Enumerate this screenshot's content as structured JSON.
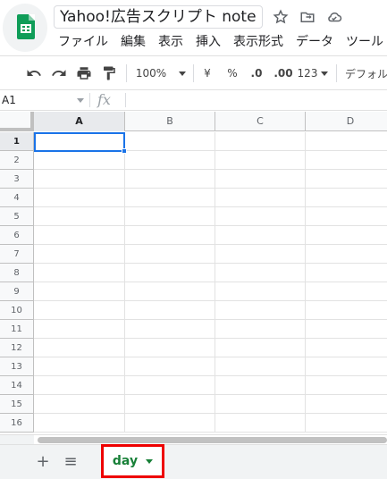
{
  "header": {
    "doc_title": "Yahoo!広告スクリプト note",
    "icons": [
      "star-icon",
      "move-to-folder-icon",
      "cloud-status-icon"
    ]
  },
  "menu": [
    "ファイル",
    "編集",
    "表示",
    "挿入",
    "表示形式",
    "データ",
    "ツール"
  ],
  "toolbar": {
    "zoom": "100%",
    "currency": "¥",
    "percent": "%",
    "decimal_decrease": ".0",
    "decimal_increase": ".00",
    "number_format": "123",
    "font": "デフォル"
  },
  "formula_bar": {
    "name_box": "A1",
    "fx": "fx"
  },
  "grid": {
    "columns": [
      "A",
      "B",
      "C",
      "D"
    ],
    "rows": [
      "1",
      "2",
      "3",
      "4",
      "5",
      "6",
      "7",
      "8",
      "9",
      "10",
      "11",
      "12",
      "13",
      "14",
      "15",
      "16"
    ],
    "selected_cell": "A1"
  },
  "sheets": {
    "add": "+",
    "all_sheets": "≡",
    "active_tab": "day"
  },
  "colors": {
    "accent": "#1a73e8",
    "sheet_green": "#0f9d58",
    "tab_highlight": "#ee0000"
  }
}
